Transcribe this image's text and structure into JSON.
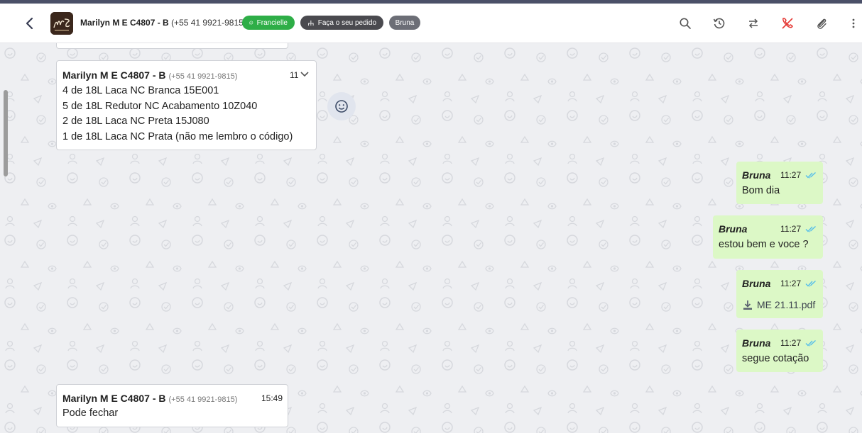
{
  "header": {
    "contact_name": "Marilyn M E C4807 - B",
    "contact_phone": "(+55 41 9921-9815)",
    "tags": [
      "Francielle",
      "Faça o seu pedido",
      "Bruna"
    ],
    "icons": [
      "search-icon",
      "history-icon",
      "transfer-icon",
      "end-chat-icon",
      "attach-icon",
      "more-icon"
    ]
  },
  "messages": [
    {
      "direction": "in",
      "sender": "Marilyn M E C4807 - B",
      "phone": "(+55 41 9921-9815)",
      "time": "11",
      "lines": [
        "4 de 18L Laca NC Branca 15E001",
        "5 de 18L Redutor NC Acabamento 10Z040",
        "2 de 18L Laca NC Preta 15J080",
        "1 de 18L Laca NC Prata (não me lembro o código)"
      ]
    },
    {
      "direction": "out",
      "sender": "Bruna",
      "time": "11:27",
      "text": "Bom dia"
    },
    {
      "direction": "out",
      "sender": "Bruna",
      "time": "11:27",
      "text": "estou bem e voce ?"
    },
    {
      "direction": "out",
      "sender": "Bruna",
      "time": "11:27",
      "file": "ME 21.11.pdf"
    },
    {
      "direction": "out",
      "sender": "Bruna",
      "time": "11:27",
      "text": "segue cotação"
    },
    {
      "direction": "in",
      "sender": "Marilyn M E C4807 - B",
      "phone": "(+55 41 9921-9815)",
      "time": "15:49",
      "text": "Pode fechar"
    }
  ],
  "colors": {
    "whatsapp_tag": "#2eae47",
    "outgoing_bubble": "#dcf8c6",
    "read_check": "#53bdeb",
    "end_chat_icon": "#e53935"
  }
}
